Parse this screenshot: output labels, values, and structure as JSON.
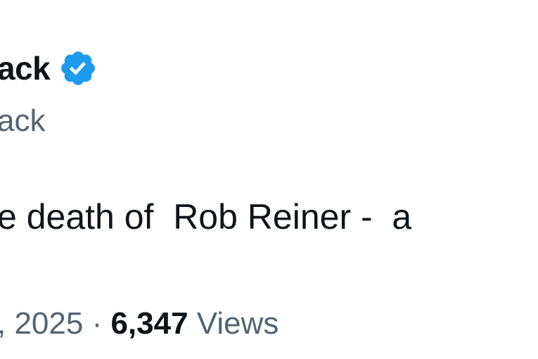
{
  "tweet": {
    "display_name": "ack",
    "handle": "ack",
    "text": "e death of  Rob Reiner -  a",
    "date": ", 2025",
    "separator": " · ",
    "views_count": "6,347",
    "views_label": " Views"
  },
  "icons": {
    "verified": "verified-badge-icon"
  },
  "colors": {
    "verified_blue": "#1d9bf0",
    "primary_text": "#0f1419",
    "secondary_text": "#536471",
    "background": "#ffffff"
  }
}
